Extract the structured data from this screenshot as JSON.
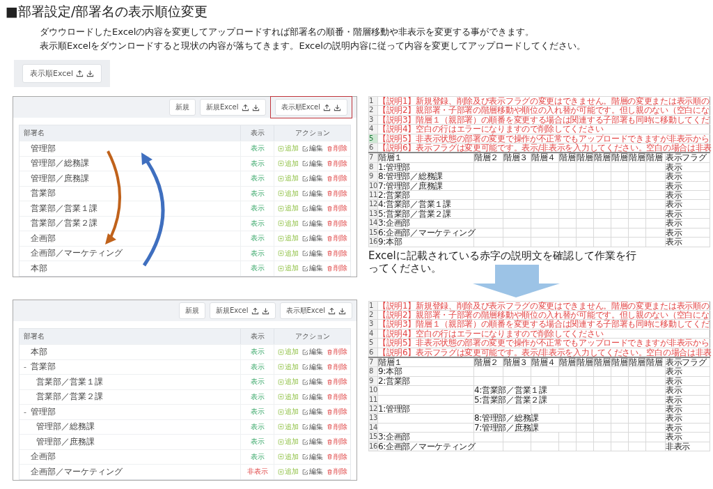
{
  "title": "■部署設定/部署名の表示順位変更",
  "description": [
    "ダウウロードしたExcelの内容を変更してアップロードすれば部署名の順番・階層移動や非表示を変更する事ができます。",
    "表示順Excelをダウンロードすると現状の内容が落ちてきます。Excelの説明内容に従って内容を変更してアップロードしてください。"
  ],
  "preview_button": {
    "label": "表示順Excel",
    "kind": "excel"
  },
  "screens": [
    {
      "toolbar": [
        {
          "label": "新規",
          "kind": "plain",
          "highlighted": false
        },
        {
          "label": "新規Excel",
          "kind": "excel",
          "highlighted": false
        },
        {
          "label": "表示順Excel",
          "kind": "excel",
          "highlighted": true
        }
      ],
      "columns": [
        "部署名",
        "表示",
        "アクション"
      ],
      "arrows": [
        {
          "color": "#c0621b"
        },
        {
          "color": "#3f6fbf"
        }
      ],
      "rows": [
        {
          "name": "管理部",
          "status": "表示",
          "hidden": false,
          "actions": [
            "追加",
            "編集",
            "削除"
          ]
        },
        {
          "name": "管理部／総務課",
          "status": "表示",
          "hidden": false,
          "actions": [
            "追加",
            "編集",
            "削除"
          ]
        },
        {
          "name": "管理部／庶務課",
          "status": "表示",
          "hidden": false,
          "actions": [
            "追加",
            "編集",
            "削除"
          ]
        },
        {
          "name": "営業部",
          "status": "表示",
          "hidden": false,
          "actions": [
            "追加",
            "編集",
            "削除"
          ]
        },
        {
          "name": "営業部／営業１課",
          "status": "表示",
          "hidden": false,
          "actions": [
            "追加",
            "編集",
            "削除"
          ]
        },
        {
          "name": "営業部／営業２課",
          "status": "表示",
          "hidden": false,
          "actions": [
            "追加",
            "編集",
            "削除"
          ]
        },
        {
          "name": "企画部",
          "status": "表示",
          "hidden": false,
          "actions": [
            "追加",
            "編集",
            "削除"
          ]
        },
        {
          "name": "企画部／マーケティング",
          "status": "表示",
          "hidden": false,
          "actions": [
            "追加",
            "編集",
            "削除"
          ]
        },
        {
          "name": "本部",
          "status": "表示",
          "hidden": false,
          "actions": [
            "追加",
            "編集",
            "削除"
          ]
        }
      ]
    },
    {
      "toolbar": [
        {
          "label": "新規",
          "kind": "plain",
          "highlighted": false
        },
        {
          "label": "新規Excel",
          "kind": "excel",
          "highlighted": false
        },
        {
          "label": "表示順Excel",
          "kind": "excel",
          "highlighted": false
        }
      ],
      "columns": [
        "部署名",
        "表示",
        "アクション"
      ],
      "rows": [
        {
          "name": "本部",
          "status": "表示",
          "hidden": false,
          "actions": [
            "追加",
            "編集",
            "削除"
          ]
        },
        {
          "name": "営業部",
          "toggle": "-",
          "expanded": true,
          "status": "表示",
          "hidden": false,
          "actions": [
            "追加",
            "編集",
            "削除"
          ],
          "children": [
            {
              "name": "営業部／営業１課",
              "status": "表示",
              "hidden": false,
              "actions": [
                "追加",
                "編集",
                "削除"
              ]
            },
            {
              "name": "営業部／営業２課",
              "status": "表示",
              "hidden": false,
              "actions": [
                "追加",
                "編集",
                "削除"
              ]
            }
          ]
        },
        {
          "name": "管理部",
          "toggle": "-",
          "expanded": true,
          "status": "表示",
          "hidden": false,
          "actions": [
            "追加",
            "編集",
            "削除"
          ],
          "children": [
            {
              "name": "管理部／総務課",
              "status": "表示",
              "hidden": false,
              "actions": [
                "追加",
                "編集",
                "削除"
              ]
            },
            {
              "name": "管理部／庶務課",
              "status": "表示",
              "hidden": false,
              "actions": [
                "追加",
                "編集",
                "削除"
              ]
            }
          ]
        },
        {
          "name": "企画部",
          "status": "表示",
          "hidden": false,
          "actions": [
            "追加",
            "編集",
            "削除"
          ]
        },
        {
          "name": "企画部／マーケティング",
          "status": "非表示",
          "hidden": true,
          "actions": [
            "追加",
            "編集",
            "削除"
          ]
        }
      ]
    }
  ],
  "sheets": [
    {
      "notes": [
        {
          "number": "1",
          "text": "【説明1】新規登録、削除及び表示フラグの変更はできません。階層の変更または表示順の",
          "selected": false
        },
        {
          "number": "2",
          "text": "【説明2】親部署・子部署の階層移動や順位の入れ替が可能です。但し親のない（空白にな",
          "selected": false
        },
        {
          "number": "3",
          "text": "【説明3】階層１（親部署）の順番を変更する場合は関連する子部署も同時に移動してくだ",
          "selected": false
        },
        {
          "number": "4",
          "text": "【説明4】空白の行はエラーになりますので削除してください",
          "selected": false
        },
        {
          "number": "5",
          "text": "【説明5】非表示状態の部署の変更で操作が不正常でもアップロードできますが非表示から",
          "selected": true
        },
        {
          "number": "6",
          "text": "【説明6】表示フラグは変更可能です。表示/非表示を入力してください。空白の場合は非表",
          "selected": false
        }
      ],
      "header": {
        "number": "7",
        "cells": [
          "階層１",
          "階層２",
          "階層３",
          "階層４",
          "階層",
          "階層",
          "階層",
          "階層",
          "階層",
          "階層",
          "表示フラグ"
        ]
      },
      "rows": [
        {
          "number": "8",
          "kind": "parent",
          "name": "1:管理部",
          "flag": "表示",
          "selected": false
        },
        {
          "number": "9",
          "kind": "parent",
          "name": "8:管理部／総務課",
          "flag": "表示",
          "selected": false
        },
        {
          "number": "10",
          "kind": "parent",
          "name": "7:管理部／庶務課",
          "flag": "表示",
          "selected": false
        },
        {
          "number": "11",
          "kind": "parent",
          "name": "2:営業部",
          "flag": "表示",
          "selected": false
        },
        {
          "number": "12",
          "kind": "parent",
          "name": "4:営業部／営業１課",
          "flag": "表示",
          "selected": false
        },
        {
          "number": "13",
          "kind": "parent",
          "name": "5:営業部／営業２課",
          "flag": "表示",
          "selected": false
        },
        {
          "number": "14",
          "kind": "parent",
          "name": "3:企画部",
          "flag": "表示",
          "selected": false
        },
        {
          "number": "15",
          "kind": "parent",
          "name": "6:企画部／マーケティング",
          "flag": "表示",
          "selected": false
        },
        {
          "number": "16",
          "kind": "parent",
          "name": "9:本部",
          "flag": "表示",
          "selected": false
        }
      ]
    },
    {
      "notes": [
        {
          "number": "1",
          "text": "【説明1】新規登録、削除及び表示フラグの変更はできません。階層の変更または表示順の",
          "selected": false
        },
        {
          "number": "2",
          "text": "【説明2】親部署・子部署の階層移動や順位の入れ替が可能です。但し親のない（空白にな",
          "selected": false
        },
        {
          "number": "3",
          "text": "【説明3】階層１（親部署）の順番を変更する場合は関連する子部署も同時に移動してくだ",
          "selected": false
        },
        {
          "number": "4",
          "text": "【説明4】空白の行はエラーになりますので削除してください",
          "selected": false
        },
        {
          "number": "5",
          "text": "【説明5】非表示状態の部署の変更で操作が不正常でもアップロードできますが非表示から",
          "selected": false
        },
        {
          "number": "6",
          "text": "【説明6】表示フラグは変更可能です。表示/非表示を入力してください。空白の場合は非表",
          "selected": false
        }
      ],
      "header": {
        "number": "7",
        "cells": [
          "階層１",
          "階層２",
          "階層３",
          "階層４",
          "階層",
          "階層",
          "階層",
          "階層",
          "階層",
          "階層",
          "表示フラグ"
        ]
      },
      "rows": [
        {
          "number": "8",
          "kind": "parent",
          "name": "9:本部",
          "flag": "表示",
          "selected": false
        },
        {
          "number": "9",
          "kind": "parent",
          "name": "2:営業部",
          "flag": "表示",
          "selected": false
        },
        {
          "number": "10",
          "kind": "child",
          "name": "4:営業部／営業１課",
          "flag": "表示",
          "selected": false
        },
        {
          "number": "11",
          "kind": "child",
          "name": "5:営業部／営業２課",
          "flag": "表示",
          "selected": false
        },
        {
          "number": "12",
          "kind": "parent",
          "name": "1:管理部",
          "flag": "表示",
          "selected": false
        },
        {
          "number": "13",
          "kind": "child",
          "name": "8:管理部／総務課",
          "flag": "表示",
          "selected": false
        },
        {
          "number": "14",
          "kind": "child",
          "name": "7:管理部／庶務課",
          "flag": "表示",
          "selected": false
        },
        {
          "number": "15",
          "kind": "parent",
          "name": "3:企画部",
          "flag": "表示",
          "selected": false
        },
        {
          "number": "16",
          "kind": "parent",
          "name": "6:企画部／マーケティング",
          "flag": "非表示",
          "selected": false
        }
      ]
    }
  ],
  "instruction": "Excelに記載されている赤字の説明文を確認して作業を行ってください。"
}
